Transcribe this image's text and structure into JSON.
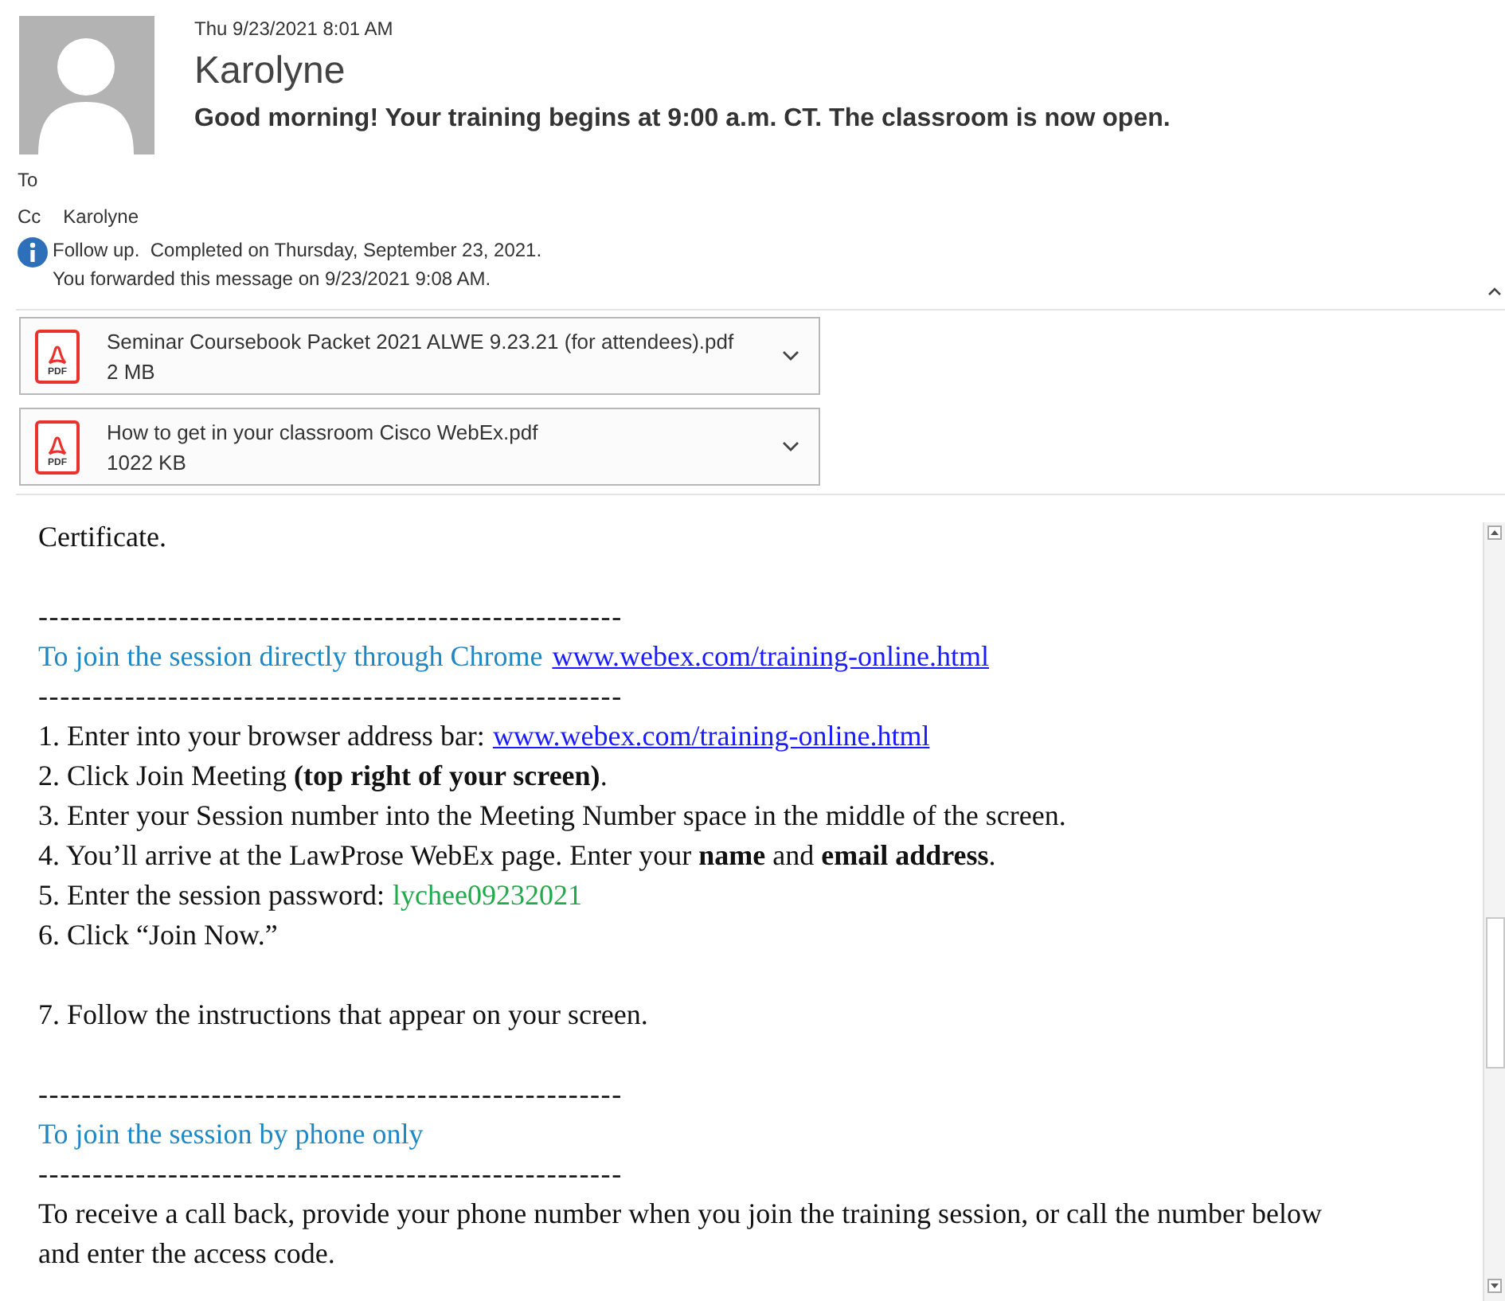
{
  "header": {
    "date": "Thu 9/23/2021 8:01 AM",
    "sender": "Karolyne",
    "subject": "Good morning! Your training begins at 9:00 a.m. CT. The classroom is now open.",
    "to_label": "To",
    "cc_label": "Cc",
    "cc": "Karolyne",
    "info": [
      "Follow up.  Completed on Thursday, September 23, 2021.",
      "You forwarded this message on 9/23/2021 9:08 AM."
    ]
  },
  "attachments": [
    {
      "name": "Seminar Coursebook Packet 2021 ALWE 9.23.21 (for attendees).pdf",
      "size": "2 MB",
      "icon": "PDF"
    },
    {
      "name": "How to get in your classroom Cisco WebEx.pdf",
      "size": "1022 KB",
      "icon": "PDF"
    }
  ],
  "body": [
    {
      "kind": "text",
      "text": "Certificate."
    },
    {
      "kind": "gap"
    },
    {
      "kind": "rule",
      "text": "------------------------------------------------------"
    },
    {
      "kind": "heading",
      "text": "To join the session directly through Chrome",
      "link": "www.webex.com/training-online.html"
    },
    {
      "kind": "rule",
      "text": "------------------------------------------------------"
    },
    {
      "kind": "text",
      "text": "1. Enter into your browser address bar:",
      "link": "www.webex.com/training-online.html"
    },
    {
      "kind": "text",
      "text": "2. Click Join Meeting **(top right of your screen)**."
    },
    {
      "kind": "text",
      "text": "3. Enter your Session number into the Meeting Number space in the middle of the screen."
    },
    {
      "kind": "text",
      "text": "4. You’ll arrive at the LawProse WebEx page. Enter your **name** and **email address**."
    },
    {
      "kind": "text",
      "text": "5. Enter the session password:",
      "password": "lychee09232021"
    },
    {
      "kind": "text",
      "text": "6. Click “Join Now.”"
    },
    {
      "kind": "gap"
    },
    {
      "kind": "text",
      "text": "7. Follow the instructions that appear on your screen."
    },
    {
      "kind": "gap"
    },
    {
      "kind": "rule",
      "text": "------------------------------------------------------"
    },
    {
      "kind": "heading",
      "text": "To join the session by phone only"
    },
    {
      "kind": "rule",
      "text": "------------------------------------------------------"
    },
    {
      "kind": "text",
      "text": "To receive a call back, provide your phone number when you join the training session, or call the number below and enter the access code."
    }
  ]
}
